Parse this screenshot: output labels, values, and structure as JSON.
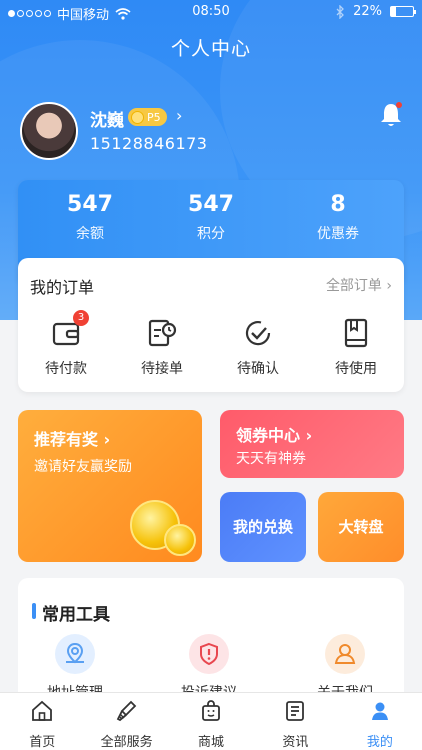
{
  "status_bar": {
    "carrier": "中国移动",
    "time": "08:50",
    "battery": "22%",
    "battery_level": 0.22
  },
  "header": {
    "title": "个人中心"
  },
  "profile": {
    "name": "沈巍",
    "level": "P5",
    "phone": "15128846173",
    "has_notification": true
  },
  "stats": [
    {
      "value": "547",
      "label": "余额"
    },
    {
      "value": "547",
      "label": "积分"
    },
    {
      "value": "8",
      "label": "优惠券"
    }
  ],
  "orders": {
    "title": "我的订单",
    "all_label": "全部订单",
    "items": [
      {
        "label": "待付款",
        "icon": "wallet-icon",
        "badge": "3"
      },
      {
        "label": "待接单",
        "icon": "clock-document-icon"
      },
      {
        "label": "待确认",
        "icon": "check-circle-icon"
      },
      {
        "label": "待使用",
        "icon": "book-icon"
      }
    ]
  },
  "promos": {
    "recommend": {
      "title": "推荐有奖",
      "subtitle": "邀请好友赢奖励"
    },
    "coupon_center": {
      "title": "领券中心",
      "subtitle": "天天有神券"
    },
    "exchange": {
      "title": "我的兑换"
    },
    "wheel": {
      "title": "大转盘"
    }
  },
  "tools": {
    "title": "常用工具",
    "items": [
      {
        "label": "地址管理",
        "icon": "location-icon",
        "color": "#5aa0f2"
      },
      {
        "label": "投诉建议",
        "icon": "shield-alert-icon",
        "color": "#e8474f"
      },
      {
        "label": "关于我们",
        "icon": "user-icon",
        "color": "#f08a2c"
      }
    ]
  },
  "tabbar": [
    {
      "label": "首页",
      "icon": "home-icon"
    },
    {
      "label": "全部服务",
      "icon": "brush-icon"
    },
    {
      "label": "商城",
      "icon": "shopping-bag-icon"
    },
    {
      "label": "资讯",
      "icon": "news-icon"
    },
    {
      "label": "我的",
      "icon": "profile-icon",
      "active": true
    }
  ],
  "colors": {
    "primary": "#3b8ff5",
    "badge": "#f04134",
    "orange": "#ff8a1f",
    "red": "#ff5b6a"
  }
}
